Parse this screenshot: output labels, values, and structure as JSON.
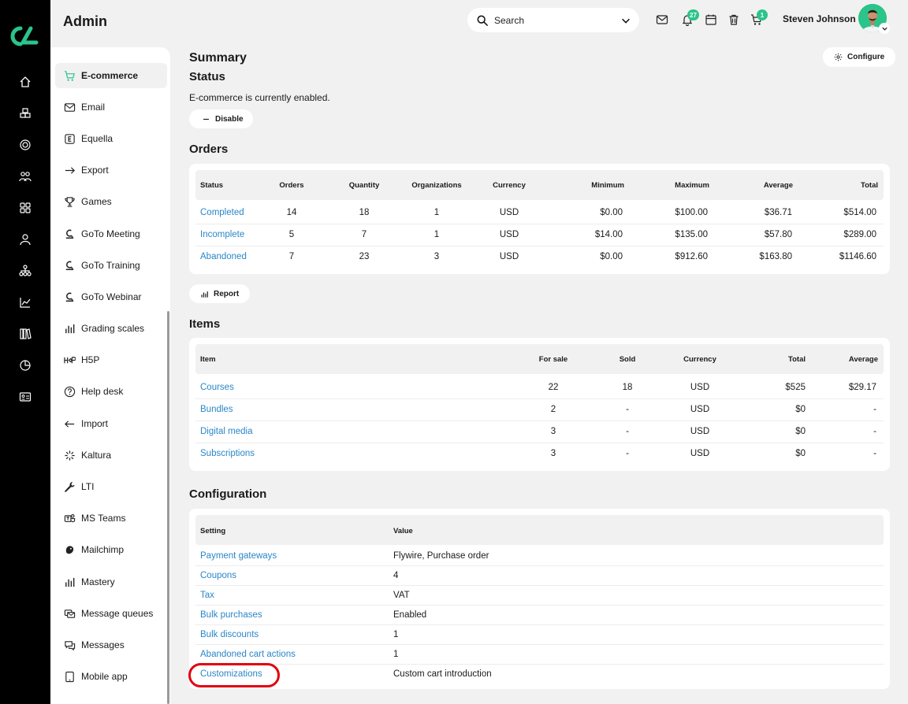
{
  "app": {
    "title": "Admin"
  },
  "header": {
    "search_placeholder": "Search",
    "notifications_count": "27",
    "cart_count": "1",
    "user_name": "Steven Johnson"
  },
  "sidebar": {
    "items": [
      {
        "label": "E-commerce",
        "icon": "cart-icon",
        "active": true
      },
      {
        "label": "Email",
        "icon": "mail-icon"
      },
      {
        "label": "Equella",
        "icon": "equella-icon"
      },
      {
        "label": "Export",
        "icon": "export-icon"
      },
      {
        "label": "Games",
        "icon": "trophy-icon"
      },
      {
        "label": "GoTo Meeting",
        "icon": "goto-icon"
      },
      {
        "label": "GoTo Training",
        "icon": "goto-icon"
      },
      {
        "label": "GoTo Webinar",
        "icon": "goto-icon"
      },
      {
        "label": "Grading scales",
        "icon": "bars-icon"
      },
      {
        "label": "H5P",
        "icon": "h5p-icon"
      },
      {
        "label": "Help desk",
        "icon": "help-icon"
      },
      {
        "label": "Import",
        "icon": "import-icon"
      },
      {
        "label": "Kaltura",
        "icon": "kaltura-icon"
      },
      {
        "label": "LTI",
        "icon": "wrench-icon"
      },
      {
        "label": "MS Teams",
        "icon": "teams-icon"
      },
      {
        "label": "Mailchimp",
        "icon": "mailchimp-icon"
      },
      {
        "label": "Mastery",
        "icon": "bars-icon"
      },
      {
        "label": "Message queues",
        "icon": "queue-icon"
      },
      {
        "label": "Messages",
        "icon": "chat-icon"
      },
      {
        "label": "Mobile app",
        "icon": "tablet-icon"
      }
    ]
  },
  "summary": {
    "title": "Summary",
    "configure_label": "Configure",
    "status_title": "Status",
    "status_text": "E-commerce is currently enabled.",
    "disable_label": "Disable"
  },
  "orders": {
    "title": "Orders",
    "headers": [
      "Status",
      "Orders",
      "Quantity",
      "Organizations",
      "Currency",
      "Minimum",
      "Maximum",
      "Average",
      "Total"
    ],
    "rows": [
      [
        "Completed",
        "14",
        "18",
        "1",
        "USD",
        "$0.00",
        "$100.00",
        "$36.71",
        "$514.00"
      ],
      [
        "Incomplete",
        "5",
        "7",
        "1",
        "USD",
        "$14.00",
        "$135.00",
        "$57.80",
        "$289.00"
      ],
      [
        "Abandoned",
        "7",
        "23",
        "3",
        "USD",
        "$0.00",
        "$912.60",
        "$163.80",
        "$1146.60"
      ]
    ],
    "report_label": "Report"
  },
  "items": {
    "title": "Items",
    "headers": [
      "Item",
      "For sale",
      "Sold",
      "Currency",
      "Total",
      "Average"
    ],
    "rows": [
      [
        "Courses",
        "22",
        "18",
        "USD",
        "$525",
        "$29.17"
      ],
      [
        "Bundles",
        "2",
        "-",
        "USD",
        "$0",
        "-"
      ],
      [
        "Digital media",
        "3",
        "-",
        "USD",
        "$0",
        "-"
      ],
      [
        "Subscriptions",
        "3",
        "-",
        "USD",
        "$0",
        "-"
      ]
    ]
  },
  "configuration": {
    "title": "Configuration",
    "headers": [
      "Setting",
      "Value"
    ],
    "rows": [
      [
        "Payment gateways",
        "Flywire, Purchase order"
      ],
      [
        "Coupons",
        "4"
      ],
      [
        "Tax",
        "VAT"
      ],
      [
        "Bulk purchases",
        "Enabled"
      ],
      [
        "Bulk discounts",
        "1"
      ],
      [
        "Abandoned cart actions",
        "1"
      ],
      [
        "Customizations",
        "Custom cart introduction"
      ]
    ]
  },
  "colors": {
    "accent": "#2bc48a",
    "link": "#2a86c8",
    "highlight": "#e3000f"
  }
}
